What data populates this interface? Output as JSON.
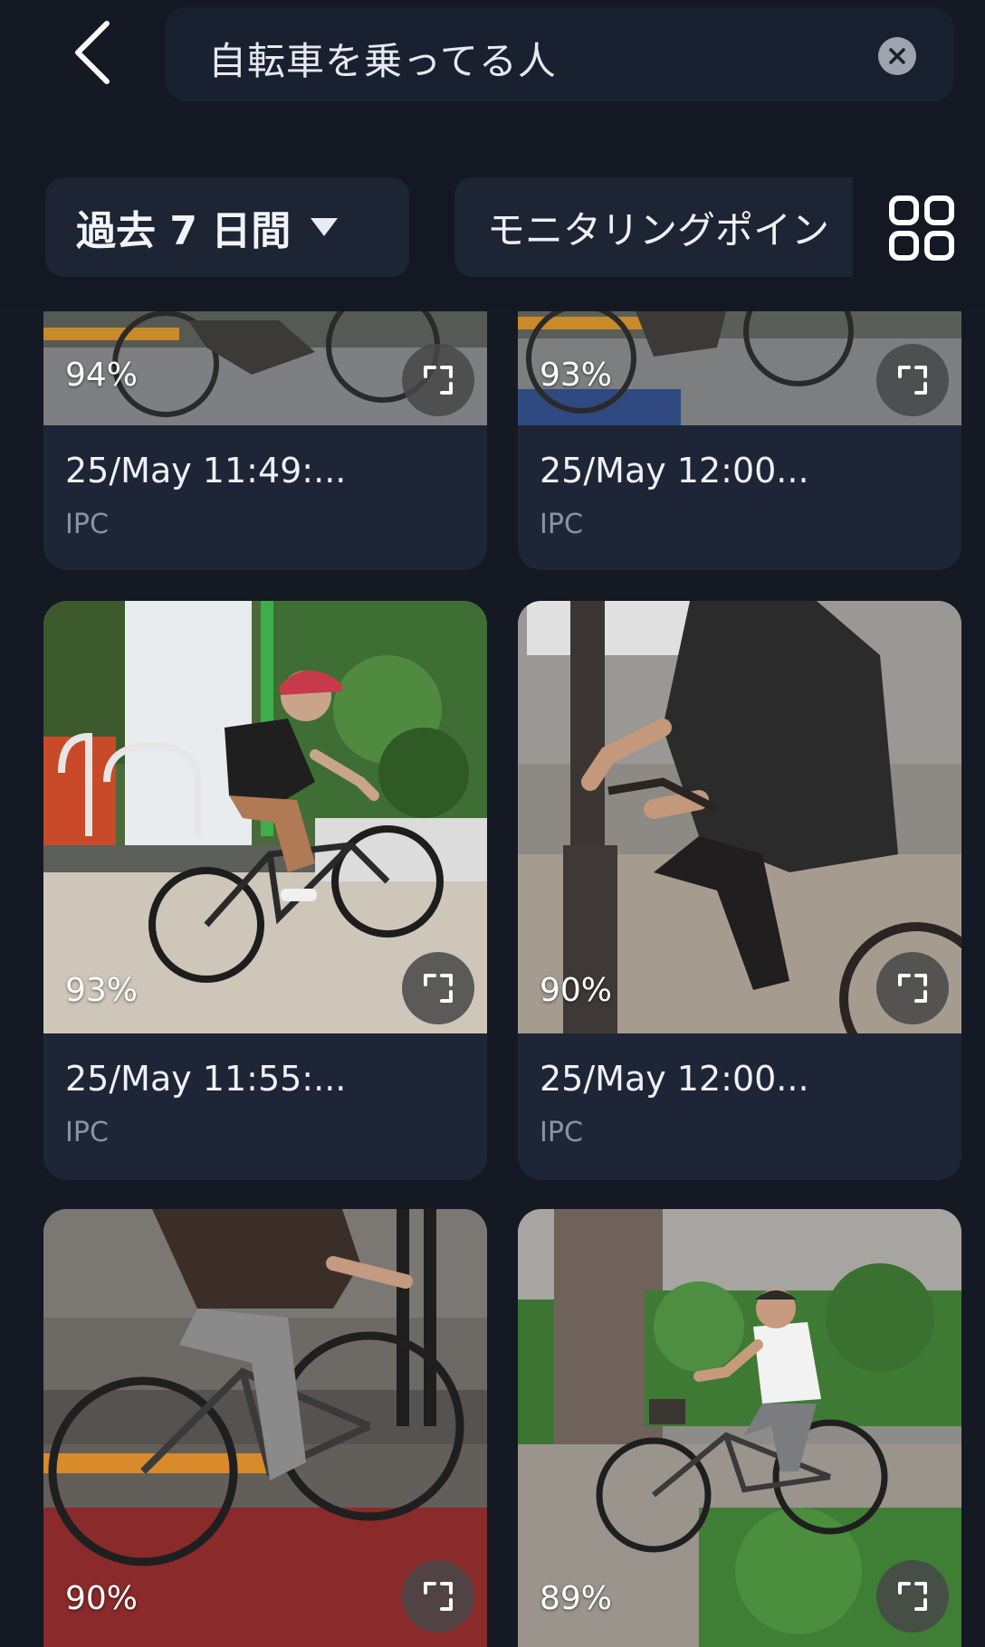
{
  "header": {
    "search_query": "自転車を乗ってる人"
  },
  "filters": {
    "date_range": "過去 7 日間",
    "monitoring_points": "モニタリングポイン"
  },
  "results": [
    {
      "score": "94%",
      "time": "25/May 11:49:...",
      "source": "IPC"
    },
    {
      "score": "93%",
      "time": "25/May 12:00...",
      "source": "IPC"
    },
    {
      "score": "93%",
      "time": "25/May 11:55:...",
      "source": "IPC"
    },
    {
      "score": "90%",
      "time": "25/May 12:00...",
      "source": "IPC"
    },
    {
      "score": "90%"
    },
    {
      "score": "89%"
    }
  ],
  "colors": {
    "background": "#131822",
    "card": "#1e2536",
    "filter_chip": "#1d2434",
    "secondary_text": "#8b93a2"
  },
  "icons": [
    "back-chevron-icon",
    "clear-icon",
    "dropdown-caret-icon",
    "grid-view-icon",
    "expand-icon"
  ]
}
